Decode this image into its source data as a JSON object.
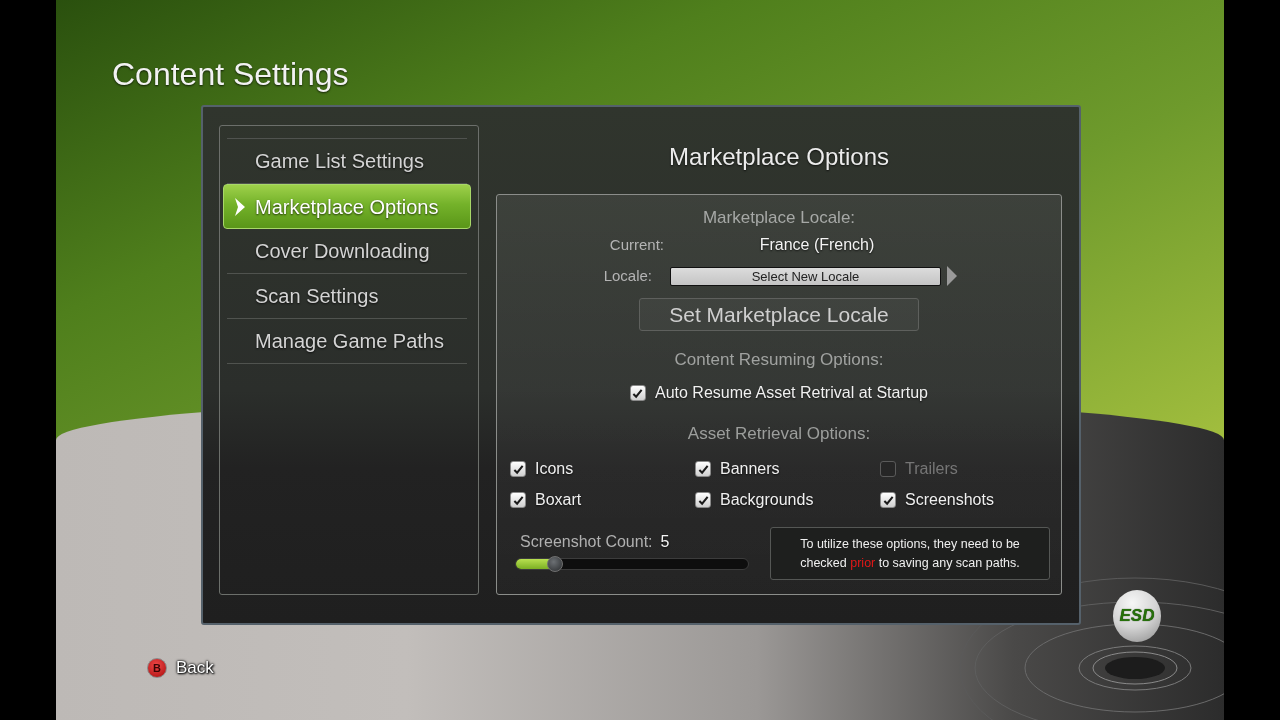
{
  "title": "Content Settings",
  "sidebar": {
    "items": [
      {
        "label": "Game List Settings",
        "selected": false
      },
      {
        "label": "Marketplace Options",
        "selected": true
      },
      {
        "label": "Cover Downloading",
        "selected": false
      },
      {
        "label": "Scan Settings",
        "selected": false
      },
      {
        "label": "Manage Game Paths",
        "selected": false
      }
    ]
  },
  "content": {
    "heading": "Marketplace Options",
    "locale": {
      "heading": "Marketplace Locale:",
      "current_label": "Current:",
      "current_value": "France (French)",
      "locale_label": "Locale:",
      "locale_select": "Select New Locale",
      "set_button": "Set Marketplace Locale"
    },
    "resuming": {
      "heading": "Content Resuming Options:",
      "options": [
        {
          "label": "Auto Resume Asset Retrival at Startup",
          "checked": true,
          "disabled": false
        }
      ]
    },
    "retrieval": {
      "heading": "Asset Retrieval Options:",
      "options": [
        {
          "label": "Icons",
          "checked": true,
          "disabled": false
        },
        {
          "label": "Banners",
          "checked": true,
          "disabled": false
        },
        {
          "label": "Trailers",
          "checked": false,
          "disabled": true
        },
        {
          "label": "Boxart",
          "checked": true,
          "disabled": false
        },
        {
          "label": "Backgrounds",
          "checked": true,
          "disabled": false
        },
        {
          "label": "Screenshots",
          "checked": true,
          "disabled": false
        }
      ]
    },
    "screenshot_count": {
      "label": "Screenshot Count:",
      "value": "5",
      "level": 0.17
    },
    "note": {
      "parts": [
        {
          "text": "To utilize these options, they need to be checked ",
          "highlight": false
        },
        {
          "text": "prior",
          "highlight": true
        },
        {
          "text": " to saving any scan paths.",
          "highlight": false
        }
      ]
    }
  },
  "back": {
    "button": "B",
    "label": "Back"
  },
  "logo": {
    "text": "ESD"
  }
}
